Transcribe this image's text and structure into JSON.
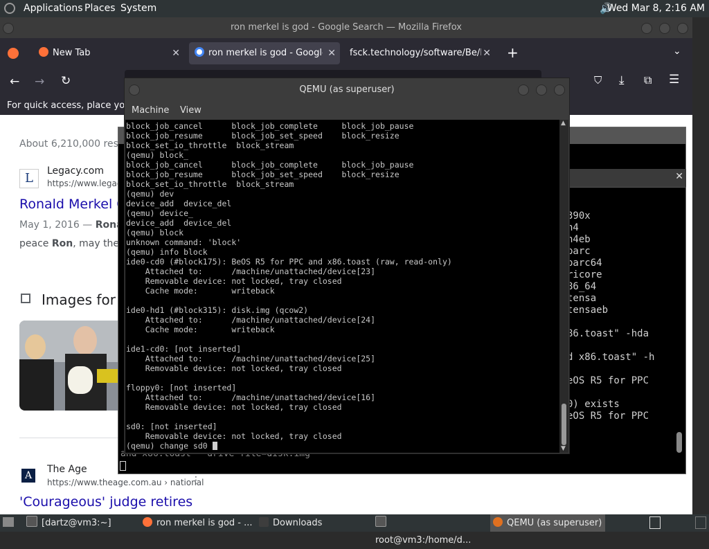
{
  "top_panel": {
    "menus": [
      "Applications",
      "Places",
      "System"
    ],
    "clock": "Wed Mar  8,  2:16 AM"
  },
  "firefox": {
    "window_title": "ron merkel is god - Google Search — Mozilla Firefox",
    "tabs": [
      {
        "label": "New Tab"
      },
      {
        "label": "ron merkel is god - Google S"
      },
      {
        "label": "fsck.technology/software/Be/Be"
      }
    ],
    "bookmarks_hint": "For quick access, place your b",
    "content": {
      "results_count": "About 6,210,000 result",
      "result1": {
        "site": "Legacy.com",
        "url": "https://www.legacy.",
        "title": "Ronald Merkel O",
        "date": "May 1, 2016 — ",
        "snippet_bold1": "Ronal",
        "snippet_line2_pre": "peace ",
        "snippet_bold2": "Ron",
        "snippet_line2_post": ", may the ",
        "snippet_bold3": "L"
      },
      "images_heading": "Images for",
      "result2": {
        "site": "The Age",
        "url": "https://www.theage.com.au › national",
        "title": "'Courageous' judge retires"
      }
    }
  },
  "terminal_bg": {
    "lines": [
      "390x",
      "h4",
      "h4eb",
      "parc",
      "parc64",
      "ricore",
      "86_64",
      "tensa",
      "tensaeb",
      "",
      "86.toast\" -hda",
      "",
      "d x86.toast\" -h",
      "",
      "eOS R5 for PPC",
      "",
      "0) exists",
      "eOS R5 for PPC"
    ],
    "bottom_line": "and x86.toast  -drive file=disk.img"
  },
  "qemu": {
    "title": "QEMU (as superuser)",
    "menus": [
      "Machine",
      "View"
    ],
    "console_lines": [
      "block_job_cancel      block_job_complete     block_job_pause",
      "block_job_resume      block_job_set_speed    block_resize",
      "block_set_io_throttle  block_stream",
      "(qemu) block_",
      "block_job_cancel      block_job_complete     block_job_pause",
      "block_job_resume      block_job_set_speed    block_resize",
      "block_set_io_throttle  block_stream",
      "(qemu) dev",
      "device_add  device_del",
      "(qemu) device_",
      "device_add  device_del",
      "(qemu) block",
      "unknown command: 'block'",
      "(qemu) info block",
      "ide0-cd0 (#block175): BeOS R5 for PPC and x86.toast (raw, read-only)",
      "    Attached to:      /machine/unattached/device[23]",
      "    Removable device: not locked, tray closed",
      "    Cache mode:       writeback",
      "",
      "ide0-hd1 (#block315): disk.img (qcow2)",
      "    Attached to:      /machine/unattached/device[24]",
      "    Cache mode:       writeback",
      "",
      "ide1-cd0: [not inserted]",
      "    Attached to:      /machine/unattached/device[25]",
      "    Removable device: not locked, tray closed",
      "",
      "floppy0: [not inserted]",
      "    Attached to:      /machine/unattached/device[16]",
      "    Removable device: not locked, tray closed",
      "",
      "sd0: [not inserted]",
      "    Removable device: not locked, tray closed"
    ],
    "prompt_line": "(qemu) change sd0 "
  },
  "taskbar": {
    "items": [
      {
        "label": "[dartz@vm3:~]"
      },
      {
        "label": "ron merkel is god - ..."
      },
      {
        "label": "Downloads"
      },
      {
        "label": "root@vm3:/home/d..."
      },
      {
        "label": "QEMU (as superuser)"
      }
    ]
  },
  "colors": {
    "panel": "#2e3436",
    "firefox_chrome": "#2b2a33",
    "link": "#1a0dab"
  }
}
